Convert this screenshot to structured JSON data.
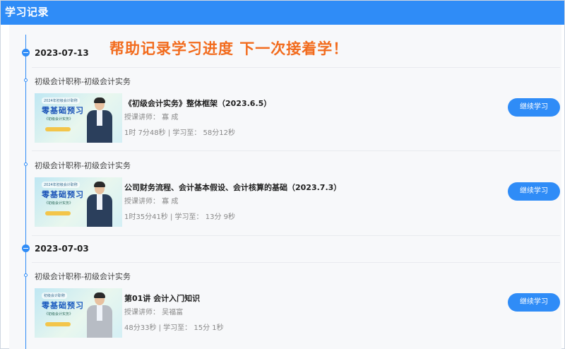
{
  "header": {
    "title": "学习记录"
  },
  "promo": "帮助记录学习进度  下一次接着学！",
  "groups": [
    {
      "date": "2023-07-13",
      "records": [
        {
          "category": "初级会计职称-初级会计实务",
          "title": "《初级会计实务》整体框架（2023.6.5）",
          "teacher": "授课讲师：  寡  成",
          "progress": "1时 7分48秒 | 学习至：  58分12秒",
          "button": "继续学习",
          "thumb": {
            "tag": "2024年初级会计职称",
            "big": "零基础预习",
            "sub": "《初级会计实务》"
          }
        },
        {
          "category": "初级会计职称-初级会计实务",
          "title": "公司财务流程、会计基本假设、会计核算的基础（2023.7.3）",
          "teacher": "授课讲师：  寡  成",
          "progress": "1时35分41秒 | 学习至：  13分 9秒",
          "button": "继续学习",
          "thumb": {
            "tag": "2024年初级会计职称",
            "big": "零基础预习",
            "sub": "《初级会计实务》"
          }
        }
      ]
    },
    {
      "date": "2023-07-03",
      "records": [
        {
          "category": "初级会计职称-初级会计实务",
          "title": "第01讲    会计入门知识",
          "teacher": "授课讲师：  吴福富",
          "progress": "48分33秒 | 学习至：  15分 1秒",
          "button": "继续学习",
          "thumb": {
            "tag": "初级会计职称",
            "big": "零基础预习",
            "sub": "《初级会计实务》"
          }
        }
      ]
    }
  ],
  "colors": {
    "accent": "#2f8cf7",
    "promo": "#f26b1d"
  }
}
